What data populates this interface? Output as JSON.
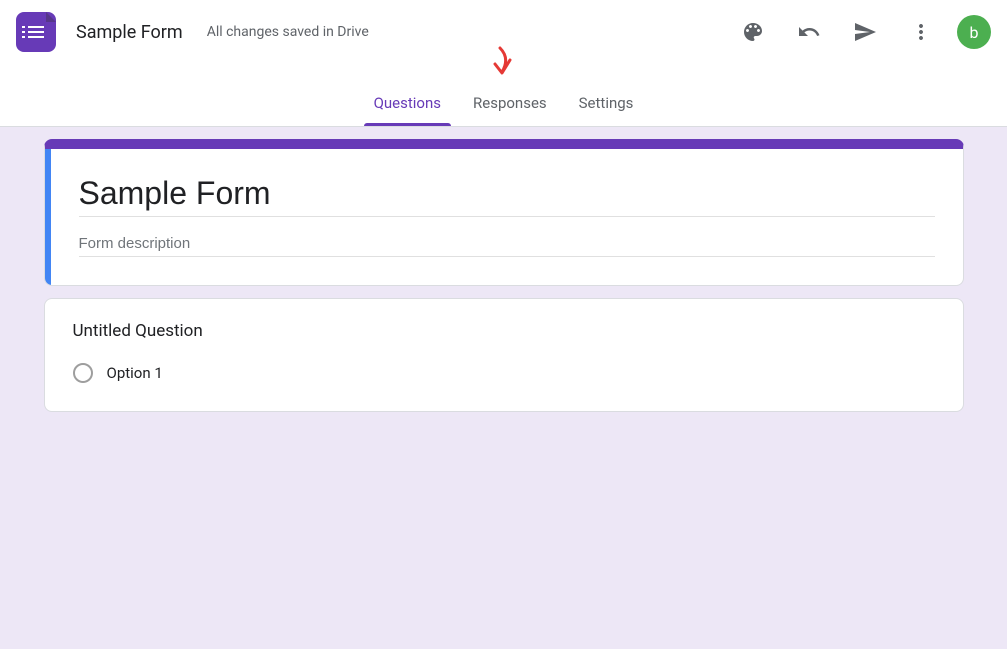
{
  "header": {
    "form_name": "Sample Form",
    "save_status": "All changes saved in Drive",
    "avatar_initial": "b"
  },
  "tabs": {
    "questions": "Questions",
    "responses": "Responses",
    "settings": "Settings"
  },
  "form": {
    "title": "Sample Form",
    "description_placeholder": "Form description",
    "description_value": ""
  },
  "question": {
    "title": "Untitled Question",
    "options": [
      {
        "label": "Option 1"
      }
    ]
  },
  "colors": {
    "accent": "#673ab7",
    "canvas": "#ede7f6",
    "focus_bar": "#4285f4",
    "avatar_bg": "#4caf50"
  }
}
